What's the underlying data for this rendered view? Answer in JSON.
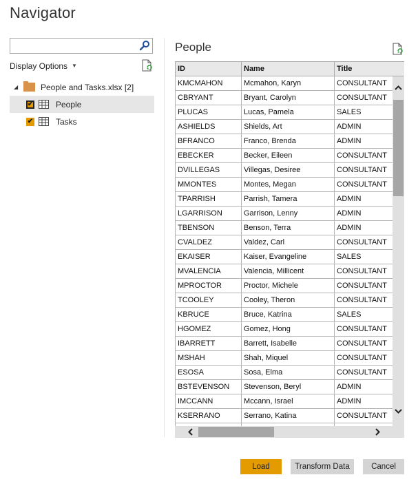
{
  "window": {
    "title": "Navigator"
  },
  "left_pane": {
    "search": {
      "value": "",
      "placeholder": ""
    },
    "display_options_label": "Display Options",
    "tree": {
      "root": {
        "label": "People and Tasks.xlsx [2]",
        "icon": "folder-icon",
        "expanded": true
      },
      "children": [
        {
          "label": "People",
          "checked": true,
          "selected": true,
          "icon": "table-icon"
        },
        {
          "label": "Tasks",
          "checked": true,
          "selected": false,
          "icon": "table-icon"
        }
      ]
    }
  },
  "preview": {
    "title": "People",
    "columns": [
      "ID",
      "Name",
      "Title"
    ],
    "rows": [
      [
        "KMCMAHON",
        "Mcmahon, Karyn",
        "CONSULTANT"
      ],
      [
        "CBRYANT",
        "Bryant, Carolyn",
        "CONSULTANT"
      ],
      [
        "PLUCAS",
        "Lucas, Pamela",
        "SALES"
      ],
      [
        "ASHIELDS",
        "Shields, Art",
        "ADMIN"
      ],
      [
        "BFRANCO",
        "Franco, Brenda",
        "ADMIN"
      ],
      [
        "EBECKER",
        "Becker, Eileen",
        "CONSULTANT"
      ],
      [
        "DVILLEGAS",
        "Villegas, Desiree",
        "CONSULTANT"
      ],
      [
        "MMONTES",
        "Montes, Megan",
        "CONSULTANT"
      ],
      [
        "TPARRISH",
        "Parrish, Tamera",
        "ADMIN"
      ],
      [
        "LGARRISON",
        "Garrison, Lenny",
        "ADMIN"
      ],
      [
        "TBENSON",
        "Benson, Terra",
        "ADMIN"
      ],
      [
        "CVALDEZ",
        "Valdez, Carl",
        "CONSULTANT"
      ],
      [
        "EKAISER",
        "Kaiser, Evangeline",
        "SALES"
      ],
      [
        "MVALENCIA",
        "Valencia, Millicent",
        "CONSULTANT"
      ],
      [
        "MPROCTOR",
        "Proctor, Michele",
        "CONSULTANT"
      ],
      [
        "TCOOLEY",
        "Cooley, Theron",
        "CONSULTANT"
      ],
      [
        "KBRUCE",
        "Bruce, Katrina",
        "SALES"
      ],
      [
        "HGOMEZ",
        "Gomez, Hong",
        "CONSULTANT"
      ],
      [
        "IBARRETT",
        "Barrett, Isabelle",
        "CONSULTANT"
      ],
      [
        "MSHAH",
        "Shah, Miquel",
        "CONSULTANT"
      ],
      [
        "ESOSA",
        "Sosa, Elma",
        "CONSULTANT"
      ],
      [
        "BSTEVENSON",
        "Stevenson, Beryl",
        "ADMIN"
      ],
      [
        "IMCCANN",
        "Mccann, Israel",
        "ADMIN"
      ],
      [
        "KSERRANO",
        "Serrano, Katina",
        "CONSULTANT"
      ],
      [
        "",
        "",
        ""
      ]
    ]
  },
  "buttons": {
    "load": "Load",
    "transform": "Transform Data",
    "cancel": "Cancel"
  },
  "colors": {
    "accent": "#e39b00",
    "selected_row": "#e6e6e6",
    "button_secondary": "#d4d4d4",
    "scrollbar_thumb": "#a6a6a6"
  }
}
